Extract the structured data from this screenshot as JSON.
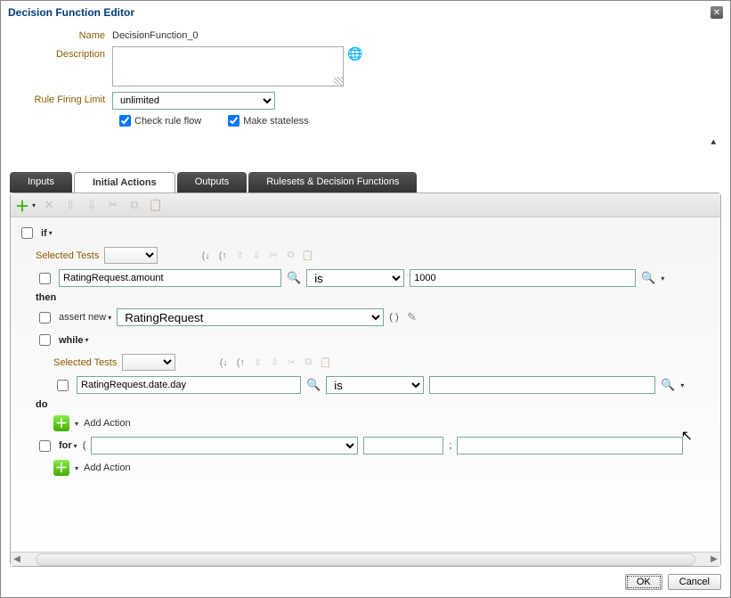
{
  "dialog": {
    "title": "Decision Function Editor"
  },
  "form": {
    "name_label": "Name",
    "name_value": "DecisionFunction_0",
    "desc_label": "Description",
    "desc_value": "",
    "rfl_label": "Rule Firing Limit",
    "rfl_value": "unlimited",
    "check_rule_flow_label": "Check rule flow",
    "make_stateless_label": "Make stateless",
    "check_rule_flow_checked": true,
    "make_stateless_checked": true
  },
  "tabs": {
    "inputs": "Inputs",
    "initial_actions": "Initial Actions",
    "outputs": "Outputs",
    "rulesets": "Rulesets & Decision Functions"
  },
  "rule": {
    "if_kw": "if",
    "then_kw": "then",
    "while_kw": "while",
    "do_kw": "do",
    "for_kw": "for",
    "selected_tests_label": "Selected Tests",
    "test1_field": "RatingRequest.amount",
    "test1_op": "is",
    "test1_value": "1000",
    "assert_kw": "assert new",
    "assert_type": "RatingRequest",
    "paren_text": "( )",
    "test2_field": "RatingRequest.date.day",
    "test2_op": "is",
    "test2_value": "",
    "add_action_label": "Add Action",
    "for_paren": "(",
    "for_semi": ";",
    "for_val1": "",
    "for_val2": "",
    "for_val3": ""
  },
  "icons": {
    "cut": "✂",
    "copy": "⧉",
    "paste": "📋",
    "up": "⇧",
    "down": "⇩",
    "delete": "✕",
    "search": "🔍",
    "edit": "✎",
    "lparen": "(↓",
    "rparen": "(↑"
  },
  "buttons": {
    "ok": "OK",
    "cancel": "Cancel"
  }
}
